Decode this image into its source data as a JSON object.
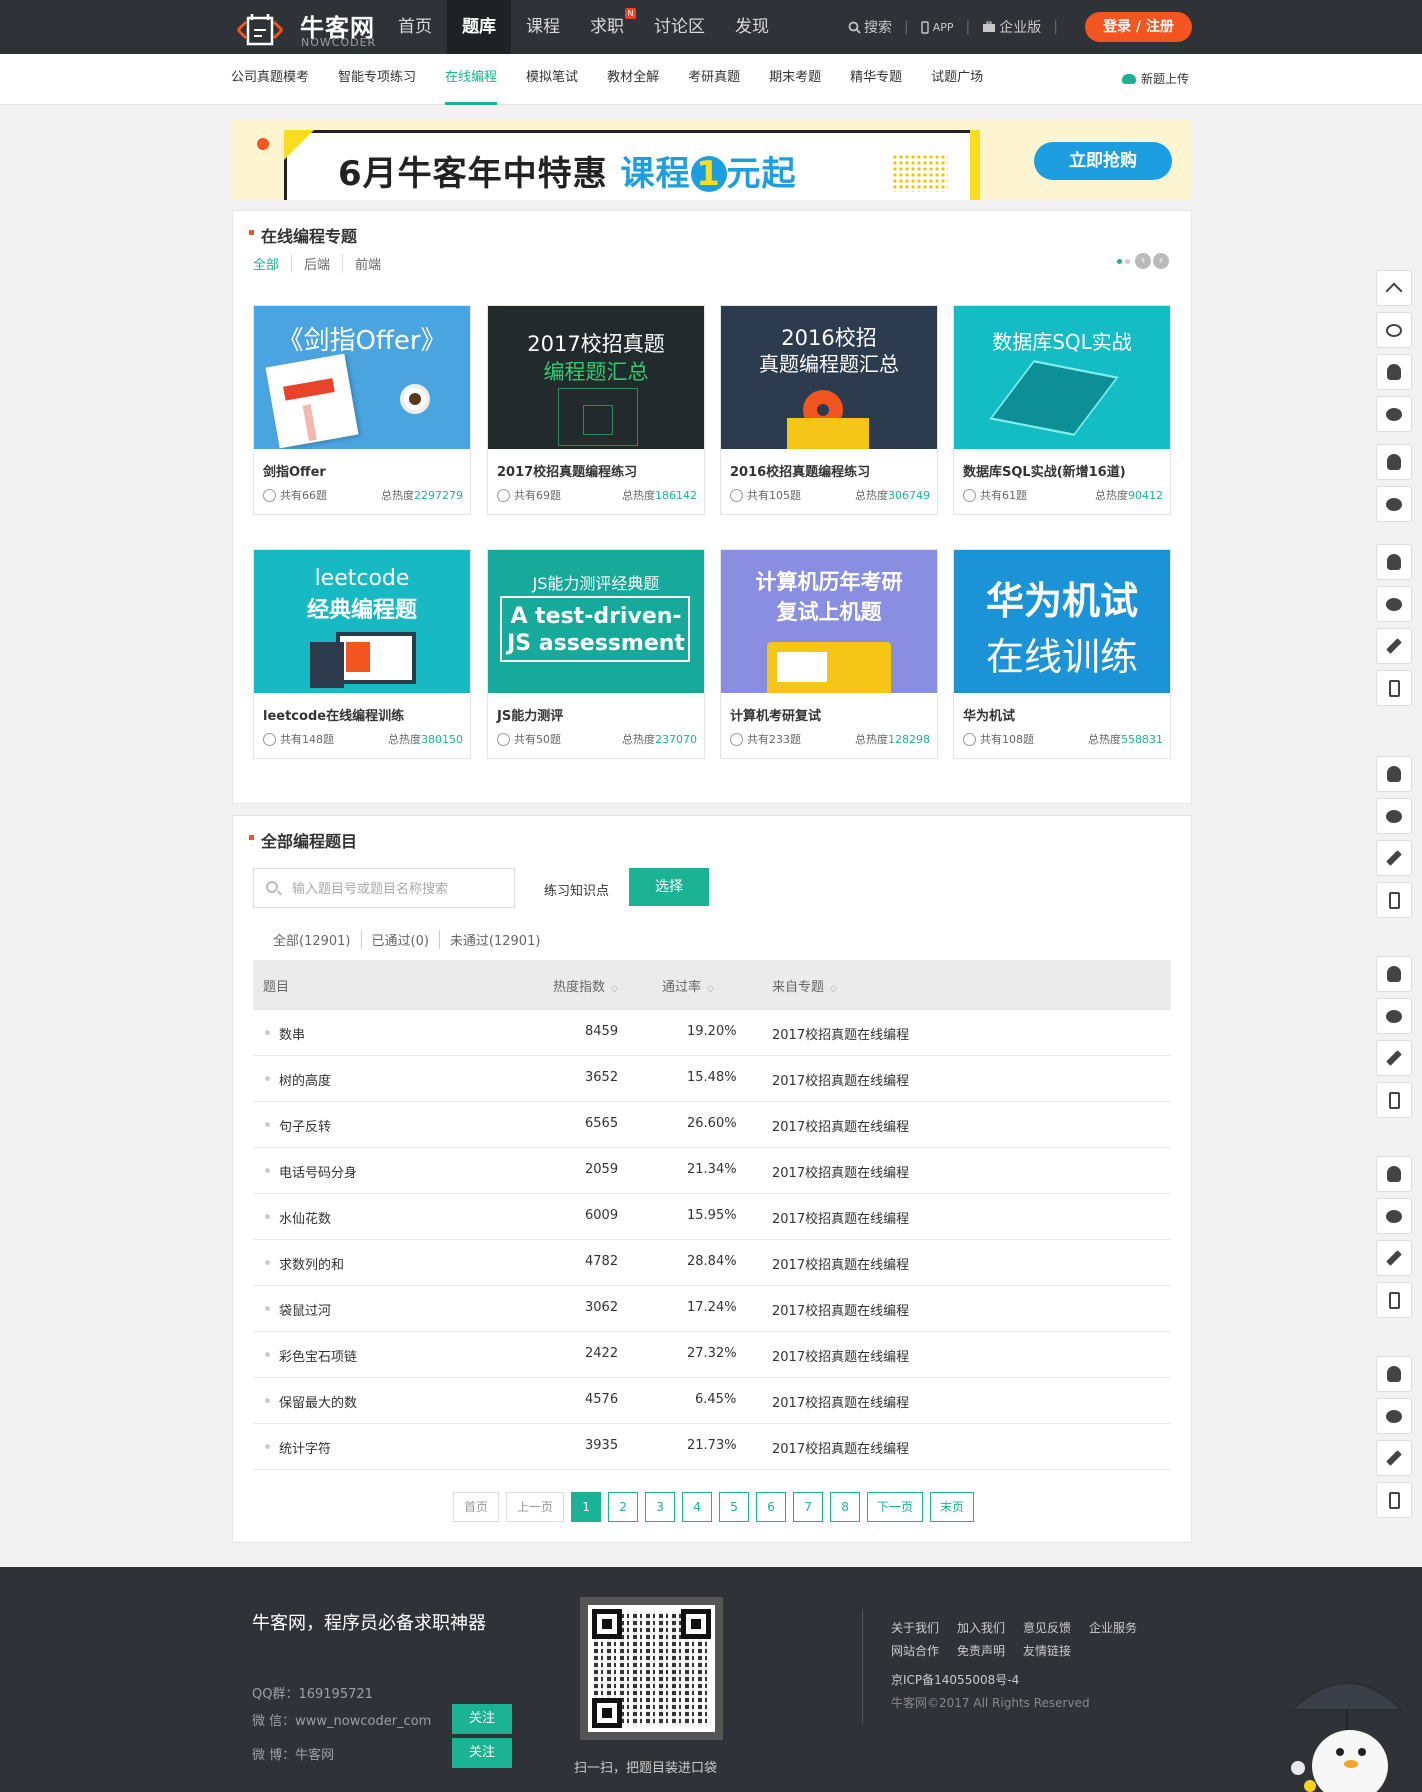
{
  "header": {
    "logo_cn": "牛客网",
    "logo_en": "NOWCODER",
    "nav": [
      "首页",
      "题库",
      "课程",
      "求职",
      "讨论区",
      "发现"
    ],
    "new_badge": "N",
    "search": "搜索",
    "app": "APP",
    "enterprise": "企业版",
    "login": "登录 / 注册"
  },
  "subnav": {
    "items": [
      "公司真题模考",
      "智能专项练习",
      "在线编程",
      "模拟笔试",
      "教材全解",
      "考研真题",
      "期末考题",
      "精华专题",
      "试题广场"
    ],
    "upload": "新题上传"
  },
  "banner": {
    "text_main": "6月牛客年中特惠",
    "text_hl1": "课程",
    "text_one": "1",
    "text_hl2": "元起",
    "button": "立即抢购"
  },
  "topics": {
    "title": "在线编程专题",
    "tabs": [
      "全部",
      "后端",
      "前端"
    ],
    "count_prefix": "共有",
    "hot_prefix": "总热度",
    "cards": [
      {
        "img_text": "《剑指Offer》",
        "name": "剑指Offer",
        "count": "66题",
        "hot": "2297279",
        "color": "#4aa4e0"
      },
      {
        "img_text": "2017校招真题",
        "img_sub": "编程题汇总",
        "name": "2017校招真题编程练习",
        "count": "69题",
        "hot": "186142",
        "color": "#222a2c"
      },
      {
        "img_text": "2016校招",
        "img_sub": "真题编程题汇总",
        "name": "2016校招真题编程练习",
        "count": "105题",
        "hot": "306749",
        "color": "#2d3b4f"
      },
      {
        "img_text": "数据库SQL实战",
        "name": "数据库SQL实战(新增16道)",
        "count": "61题",
        "hot": "90412",
        "color": "#14bcc4"
      },
      {
        "img_text": "leetcode",
        "img_sub": "经典编程题",
        "name": "leetcode在线编程训练",
        "count": "148题",
        "hot": "380150",
        "color": "#17b9c2"
      },
      {
        "img_text": "JS能力测评经典题",
        "img_sub": "A test-driven-",
        "img_sub2": "JS assessment",
        "name": "JS能力测评",
        "count": "50题",
        "hot": "237070",
        "color": "#17a99a"
      },
      {
        "img_text": "计算机历年考研",
        "img_sub": "复试上机题",
        "name": "计算机考研复试",
        "count": "233题",
        "hot": "128298",
        "color": "#8a8ee0"
      },
      {
        "img_text": "华为机试",
        "img_sub": "在线训练",
        "name": "华为机试",
        "count": "108题",
        "hot": "558831",
        "color": "#1b93d6"
      }
    ]
  },
  "problems": {
    "title": "全部编程题目",
    "search_placeholder": "输入题目号或题目名称搜索",
    "knowledge_label": "练习知识点",
    "select_button": "选择",
    "filters": [
      "全部(12901)",
      "已通过(0)",
      "未通过(12901)"
    ],
    "columns": [
      "题目",
      "热度指数",
      "通过率",
      "来自专题"
    ],
    "rows": [
      {
        "title": "数串",
        "hot": "8459",
        "rate": "19.20%",
        "topic": "2017校招真题在线编程"
      },
      {
        "title": "树的高度",
        "hot": "3652",
        "rate": "15.48%",
        "topic": "2017校招真题在线编程"
      },
      {
        "title": "句子反转",
        "hot": "6565",
        "rate": "26.60%",
        "topic": "2017校招真题在线编程"
      },
      {
        "title": "电话号码分身",
        "hot": "2059",
        "rate": "21.34%",
        "topic": "2017校招真题在线编程"
      },
      {
        "title": "水仙花数",
        "hot": "6009",
        "rate": "15.95%",
        "topic": "2017校招真题在线编程"
      },
      {
        "title": "求数列的和",
        "hot": "4782",
        "rate": "28.84%",
        "topic": "2017校招真题在线编程"
      },
      {
        "title": "袋鼠过河",
        "hot": "3062",
        "rate": "17.24%",
        "topic": "2017校招真题在线编程"
      },
      {
        "title": "彩色宝石项链",
        "hot": "2422",
        "rate": "27.32%",
        "topic": "2017校招真题在线编程"
      },
      {
        "title": "保留最大的数",
        "hot": "4576",
        "rate": "6.45%",
        "topic": "2017校招真题在线编程"
      },
      {
        "title": "统计字符",
        "hot": "3935",
        "rate": "21.73%",
        "topic": "2017校招真题在线编程"
      }
    ],
    "pager": {
      "first": "首页",
      "prev": "上一页",
      "pages": [
        "1",
        "2",
        "3",
        "4",
        "5",
        "6",
        "7",
        "8"
      ],
      "next": "下一页",
      "last": "末页",
      "current": "1"
    }
  },
  "footer": {
    "slogan": "牛客网，程序员必备求职神器",
    "qq": "QQ群：169195721",
    "wechat": "微 信：www_nowcoder_com",
    "weibo": "微 博：牛客网",
    "follow": "关注",
    "qr_caption": "扫一扫，把题目装进口袋",
    "links_row1": [
      "关于我们",
      "加入我们",
      "意见反馈",
      "企业服务"
    ],
    "links_row2": [
      "网站合作",
      "免责声明",
      "友情链接"
    ],
    "icp": "京ICP备14055008号-4",
    "copyright": "牛客网©2017 All Rights Reserved"
  },
  "colors": {
    "brand_green": "#1bb394",
    "header_bg": "#2f3337",
    "login_orange": "#f2551f",
    "banner_blue": "#1c9ee0"
  }
}
